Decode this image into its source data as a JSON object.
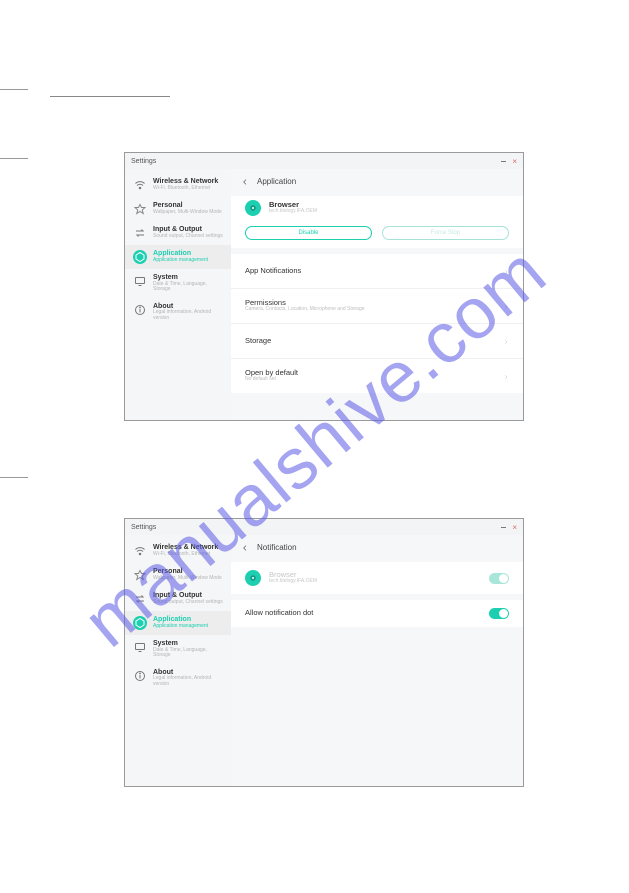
{
  "watermark": "manualshive.com",
  "window_title": "Settings",
  "sidebar": {
    "items": [
      {
        "title": "Wireless & Network",
        "sub": "Wi-Fi, Bluetooth, Ethernet"
      },
      {
        "title": "Personal",
        "sub": "Wallpaper, Multi-Window Mode"
      },
      {
        "title": "Input & Output",
        "sub": "Sound output, Channel settings"
      },
      {
        "title": "Application",
        "sub": "Application management"
      },
      {
        "title": "System",
        "sub": "Date & Time, Language, Storage"
      },
      {
        "title": "About",
        "sub": "Legal information, Android version"
      }
    ]
  },
  "panel_a": {
    "header": "Application",
    "app": {
      "name": "Browser",
      "meta": "tech.titelogy.IFA.OEM"
    },
    "buttons": {
      "disable": "Disable",
      "forcestop": "Force Stop"
    },
    "rows": {
      "notifications": {
        "title": "App Notifications"
      },
      "permissions": {
        "title": "Permissions",
        "sub": "Camera, Contacts, Location, Microphone and Storage"
      },
      "storage": {
        "title": "Storage"
      },
      "open_default": {
        "title": "Open by default",
        "sub": "No default set"
      }
    }
  },
  "panel_b": {
    "header": "Notification",
    "app": {
      "name": "Browser",
      "meta": "tech.titelogy.IFA.OEM"
    },
    "allow_dot": "Allow notification dot"
  }
}
